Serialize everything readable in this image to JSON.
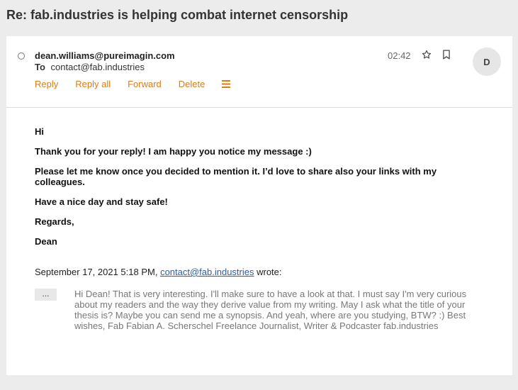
{
  "subject": "Re: fab.industries is helping combat internet censorship",
  "message": {
    "from": "dean.williams@pureimagin.com",
    "to_label": "To",
    "to": "contact@fab.industries",
    "time": "02:42",
    "avatar_initial": "D",
    "actions": {
      "reply": "Reply",
      "reply_all": "Reply all",
      "forward": "Forward",
      "delete": "Delete"
    },
    "body": [
      "Hi",
      "Thank you for your reply! I am happy you notice my message :)",
      "Please let me know once you decided to mention it. I’d love to share also your links with my colleagues.",
      "Have a nice day and stay safe!",
      "Regards,",
      "Dean"
    ],
    "quote": {
      "date": "September 17, 2021 5:18 PM, ",
      "email": "contact@fab.industries",
      "wrote": " wrote:",
      "more": "...",
      "text": "Hi Dean! That is very interesting. I'll make sure to have a look at that. I must say I'm very curious about my readers and the way they derive value from my writing. May I ask what the title of your thesis is? Maybe you can send me a synopsis. And yeah, where are you studying, BTW? :) Best wishes, Fab Fabian A. Scherschel Freelance Journalist, Writer & Podcaster fab.industries"
    }
  },
  "colors": {
    "accent": "#e07b14",
    "link": "#2a5ea8",
    "background": "#ececec"
  }
}
